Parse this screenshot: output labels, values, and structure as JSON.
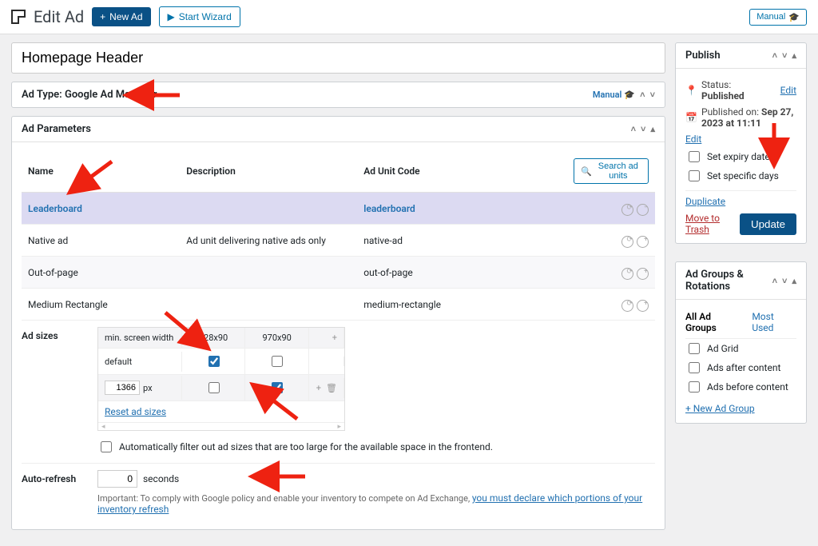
{
  "header": {
    "page_title": "Edit Ad",
    "new_ad": "New Ad",
    "start_wizard": "Start Wizard",
    "manual": "Manual"
  },
  "ad": {
    "title_value": "Homepage Header"
  },
  "ad_type": {
    "label_prefix": "Ad Type: ",
    "value": "Google Ad Manager",
    "manual": "Manual"
  },
  "ad_params": {
    "heading": "Ad Parameters",
    "search": "Search ad units",
    "columns": {
      "name": "Name",
      "description": "Description",
      "code": "Ad Unit Code"
    },
    "units": [
      {
        "name": "Leaderboard",
        "description": "",
        "code": "leaderboard",
        "selected": true
      },
      {
        "name": "Native ad",
        "description": "Ad unit delivering native ads only",
        "code": "native-ad",
        "selected": false
      },
      {
        "name": "Out-of-page",
        "description": "",
        "code": "out-of-page",
        "selected": false
      },
      {
        "name": "Medium Rectangle",
        "description": "",
        "code": "medium-rectangle",
        "selected": false
      }
    ],
    "ad_sizes": {
      "label": "Ad sizes",
      "header_cells": [
        "min. screen width",
        "728x90",
        "970x90"
      ],
      "rows": [
        {
          "label": "default",
          "col1_checked": true,
          "col2_checked": false
        },
        {
          "label_value": "1366",
          "label_unit": "px",
          "col1_checked": false,
          "col2_checked": true
        }
      ],
      "reset": "Reset ad sizes",
      "filter_label": "Automatically filter out ad sizes that are too large for the available space in the frontend."
    },
    "auto_refresh": {
      "label": "Auto-refresh",
      "value": "0",
      "unit": "seconds",
      "hint_prefix": "Important: To comply with Google policy and enable your inventory to compete on Ad Exchange, ",
      "hint_link": "you must declare which portions of your inventory refresh"
    }
  },
  "publish": {
    "heading": "Publish",
    "status_label": "Status: ",
    "status_value": "Published",
    "edit": "Edit",
    "published_on_label": "Published on: ",
    "published_on_value": "Sep 27, 2023 at 11:11",
    "expiry": "Set expiry date",
    "specific": "Set specific days",
    "duplicate": "Duplicate",
    "trash": "Move to Trash",
    "update": "Update"
  },
  "groups": {
    "heading": "Ad Groups & Rotations",
    "tab_all": "All Ad Groups",
    "tab_most": "Most Used",
    "items": [
      "Ad Grid",
      "Ads after content",
      "Ads before content"
    ],
    "add": "+ New Ad Group"
  }
}
